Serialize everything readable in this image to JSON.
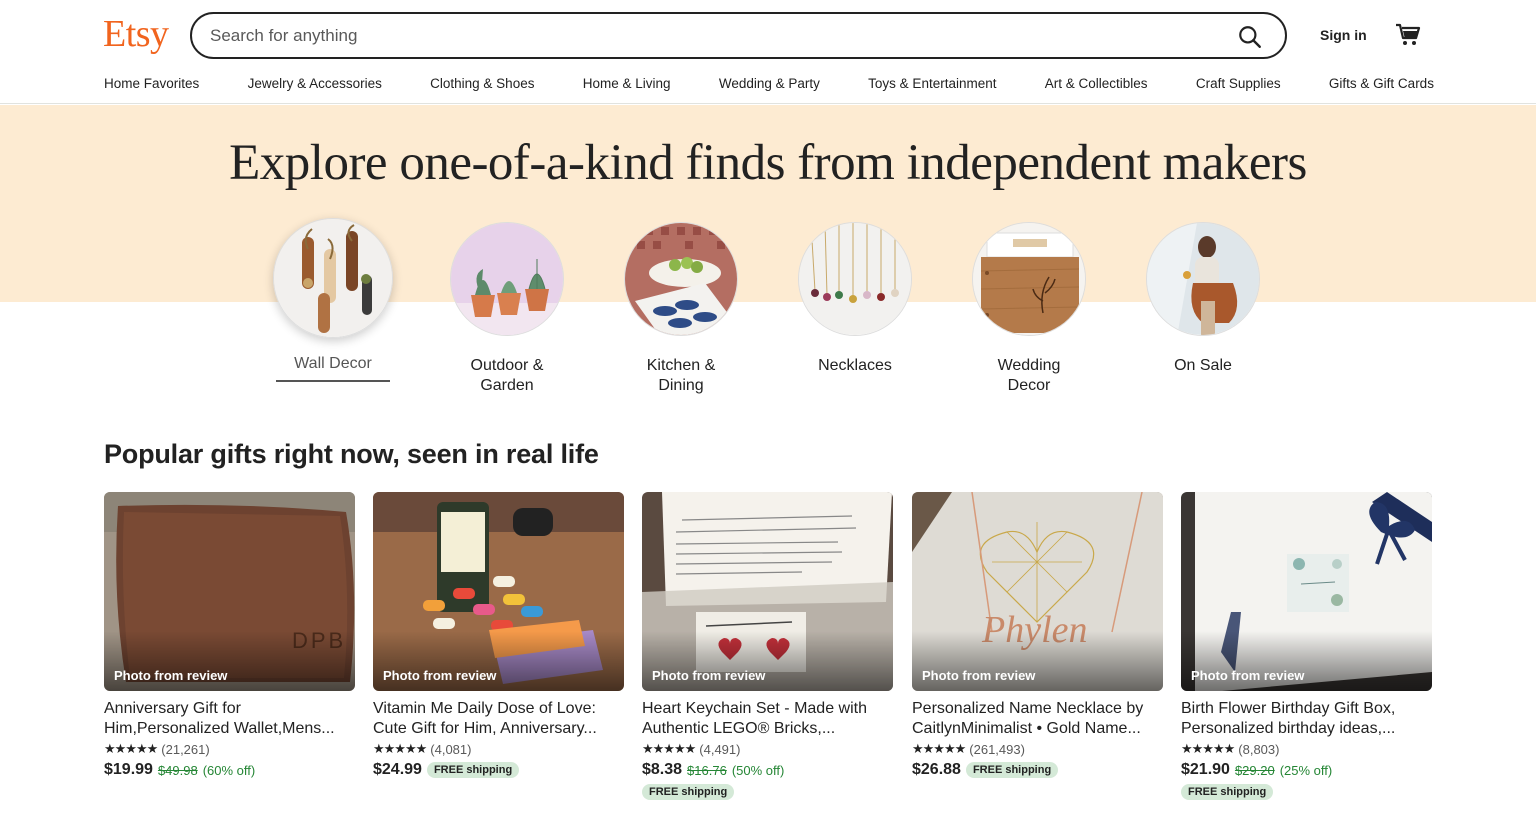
{
  "header": {
    "logo": "Etsy",
    "search_placeholder": "Search for anything",
    "sign_in": "Sign in"
  },
  "nav": [
    "Home Favorites",
    "Jewelry & Accessories",
    "Clothing & Shoes",
    "Home & Living",
    "Wedding & Party",
    "Toys & Entertainment",
    "Art & Collectibles",
    "Craft Supplies",
    "Gifts & Gift Cards"
  ],
  "hero": {
    "title": "Explore one-of-a-kind finds from independent makers",
    "categories": [
      {
        "line1": "Wall Decor",
        "line2": ""
      },
      {
        "line1": "Outdoor &",
        "line2": "Garden"
      },
      {
        "line1": "Kitchen &",
        "line2": "Dining"
      },
      {
        "line1": "Necklaces",
        "line2": ""
      },
      {
        "line1": "Wedding",
        "line2": "Decor"
      },
      {
        "line1": "On Sale",
        "line2": ""
      }
    ]
  },
  "popular": {
    "title": "Popular gifts right now, seen in real life",
    "items": [
      {
        "tag": "Photo from review",
        "title1": "Anniversary Gift for",
        "title2": "Him,Personalized Wallet,Mens...",
        "stars": "★★★★★",
        "reviews": "(21,261)",
        "price": "$19.99",
        "orig": "$49.98",
        "disc": "(60% off)",
        "free": ""
      },
      {
        "tag": "Photo from review",
        "title1": "Vitamin Me Daily Dose of Love:",
        "title2": "Cute Gift for Him, Anniversary...",
        "stars": "★★★★★",
        "reviews": "(4,081)",
        "price": "$24.99",
        "orig": "",
        "disc": "",
        "free": "FREE shipping"
      },
      {
        "tag": "Photo from review",
        "title1": "Heart Keychain Set - Made with",
        "title2": "Authentic LEGO® Bricks,...",
        "stars": "★★★★★",
        "reviews": "(4,491)",
        "price": "$8.38",
        "orig": "$16.76",
        "disc": "(50% off)",
        "free": "FREE shipping"
      },
      {
        "tag": "Photo from review",
        "title1": "Personalized Name Necklace by",
        "title2": "CaitlynMinimalist • Gold Name...",
        "stars": "★★★★★",
        "reviews": "(261,493)",
        "price": "$26.88",
        "orig": "",
        "disc": "",
        "free": "FREE shipping"
      },
      {
        "tag": "Photo from review",
        "title1": "Birth Flower Birthday Gift Box,",
        "title2": "Personalized birthday ideas,...",
        "stars": "★★★★★",
        "reviews": "(8,803)",
        "price": "$21.90",
        "orig": "$29.20",
        "disc": "(25% off)",
        "free": "FREE shipping"
      }
    ]
  },
  "colors": {
    "brand": "#f1641e",
    "hero_bg": "#fdebd2",
    "sale_green": "#258635",
    "free_badge": "#d4e9d7"
  }
}
